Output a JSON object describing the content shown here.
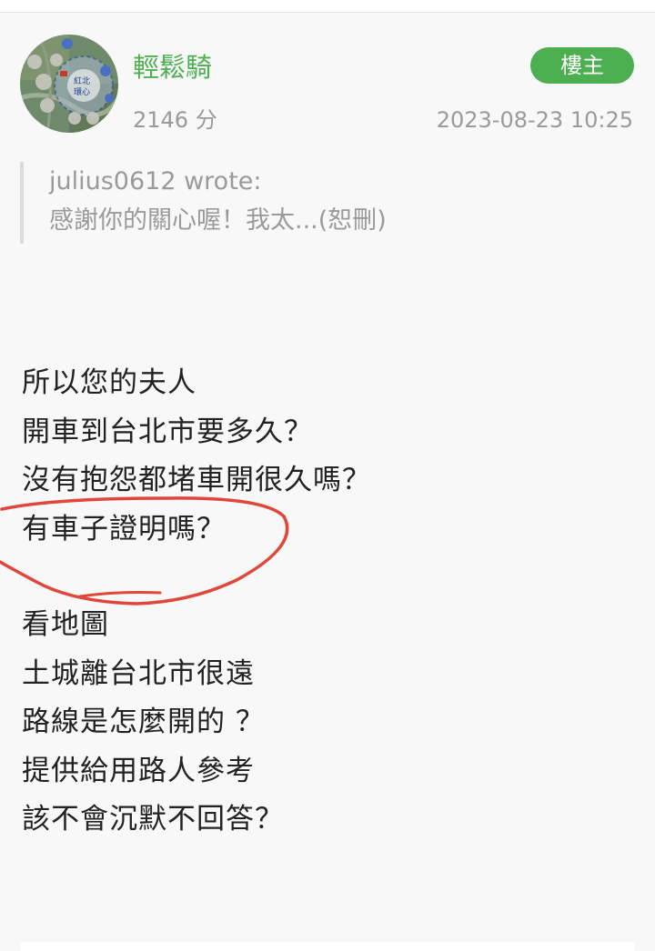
{
  "post": {
    "author": {
      "name": "輕鬆騎",
      "points": "2146 分"
    },
    "badge": "樓主",
    "timestamp": "2023-08-23 10:25",
    "quote": {
      "author_line": "julius0612 wrote:",
      "text": "感謝你的關心喔！我太...(恕刪)"
    },
    "content": {
      "lines_block1": [
        "所以您的夫人",
        "開車到台北市要多久？",
        "沒有抱怨都堵車開很久嗎？",
        "有車子證明嗎？"
      ],
      "lines_block2": [
        "看地圖",
        "土城離台北市很遠",
        "路線是怎麼開的 ？",
        "提供給用路人參考",
        "該不會沉默不回答？"
      ]
    }
  },
  "avatar": {
    "texts": [
      "紅北",
      "環心"
    ]
  },
  "colors": {
    "username": "#4caf50",
    "badge": "#4caf50",
    "annotation": "#e0473a"
  }
}
